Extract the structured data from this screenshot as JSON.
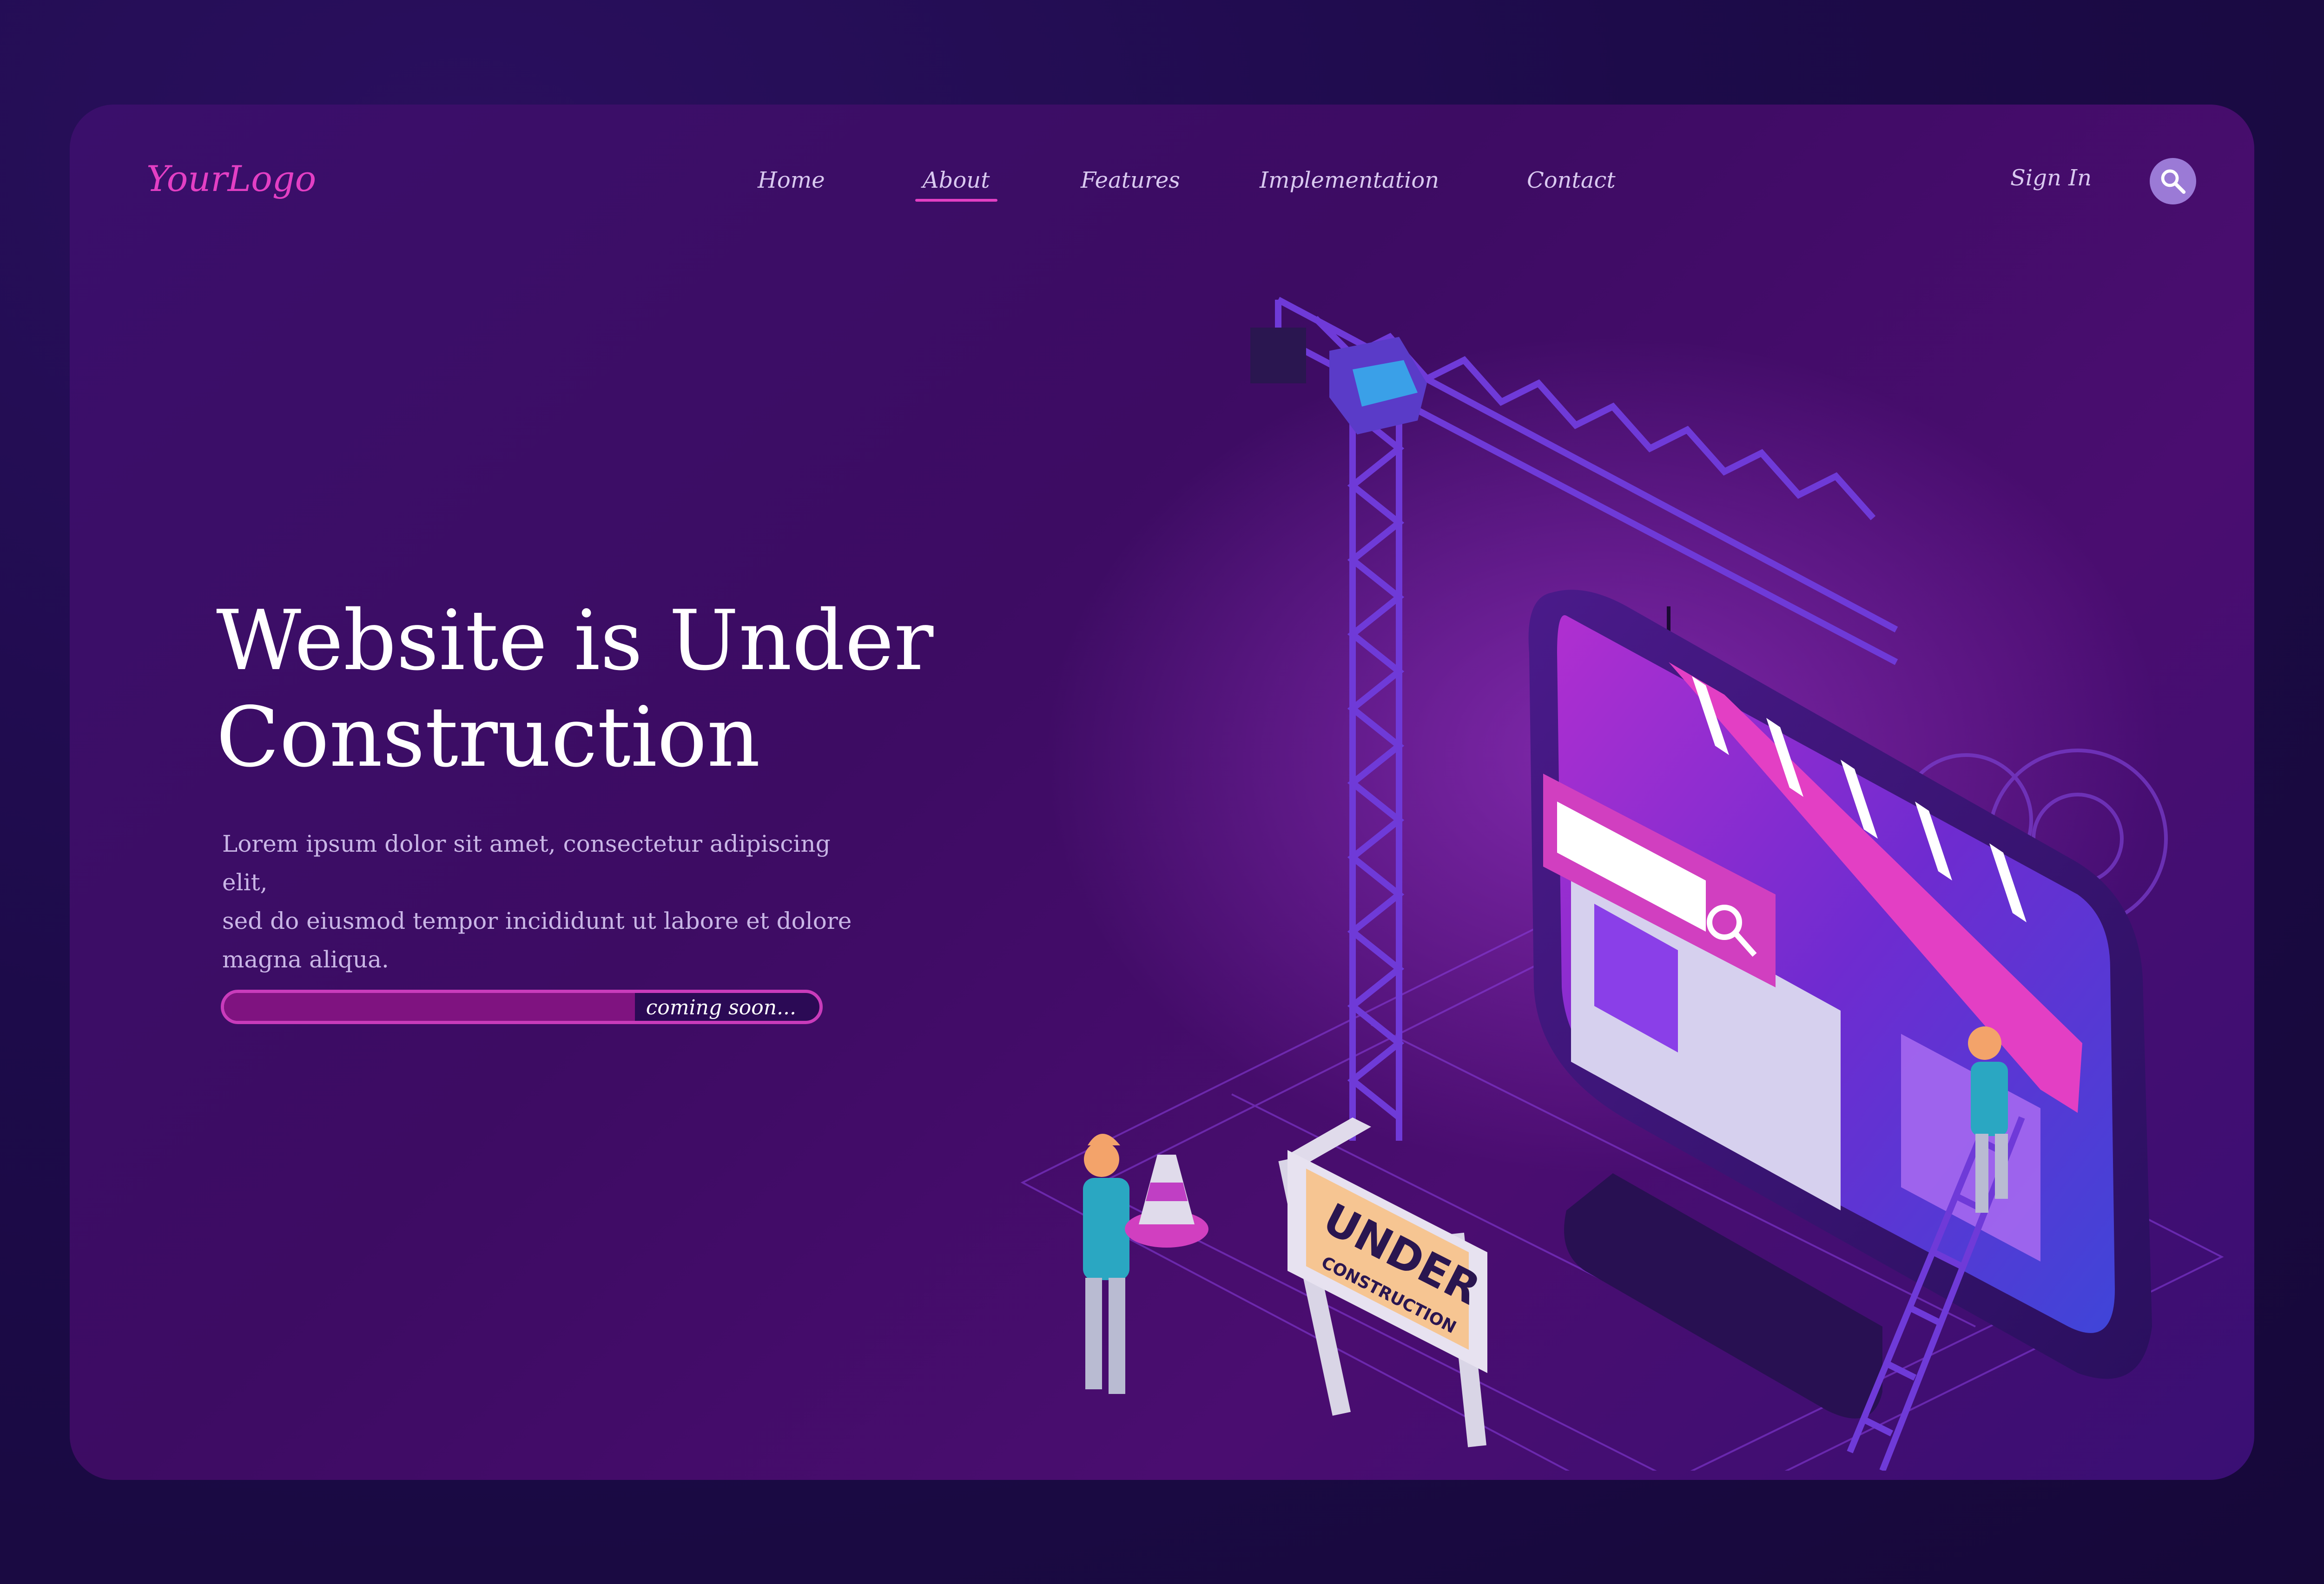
{
  "header": {
    "logo": "YourLogo",
    "nav": [
      "Home",
      "About",
      "Features",
      "Implementation",
      "Contact"
    ],
    "active_nav": "About",
    "sign_in": "Sign In",
    "search_icon": "search-icon"
  },
  "hero": {
    "title_line1": "Website is Under",
    "title_line2": "Construction",
    "description": [
      "Lorem ipsum dolor sit amet, consectetur adipiscing elit,",
      "sed do eiusmod tempor incididunt ut labore et dolore",
      "magna aliqua."
    ],
    "progress_label": "coming soon...",
    "progress_fraction": 0.69
  },
  "illustration": {
    "sign_line1": "UNDER",
    "sign_line2": "CONSTRUCTION"
  },
  "colors": {
    "accent": "#e33fc4",
    "card": "#3d0c63",
    "background": "#1d0b4a"
  }
}
